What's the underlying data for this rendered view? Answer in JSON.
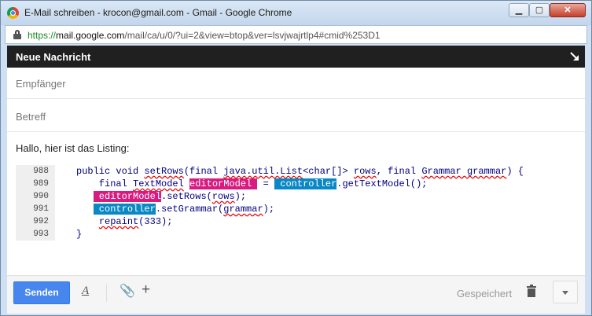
{
  "window": {
    "title": "E-Mail schreiben - krocon@gmail.com - Gmail - Google Chrome",
    "buttons": {
      "minimize": "▁",
      "maximize": "▢",
      "close": "✕"
    }
  },
  "url": {
    "scheme": "https://",
    "host": "mail.google.com",
    "path": "/mail/ca/u/0/?ui=2&view=btop&ver=lsvjwajrtlp4#cmid%253D1"
  },
  "compose": {
    "title": "Neue Nachricht",
    "to_placeholder": "Empfänger",
    "subject_placeholder": "Betreff",
    "greeting": "Hallo, hier ist das Listing:",
    "code_lines": [
      {
        "num": "988",
        "segments": [
          {
            "t": "public void "
          },
          {
            "t": "setRows",
            "sq": true
          },
          {
            "t": "(final "
          },
          {
            "t": "java.util.List",
            "sq": true
          },
          {
            "t": "<char[]> "
          },
          {
            "t": "rows",
            "sq": true
          },
          {
            "t": ", final "
          },
          {
            "t": "Grammar grammar",
            "sq": true
          },
          {
            "t": ") {"
          }
        ]
      },
      {
        "num": "989",
        "segments": [
          {
            "t": "    final "
          },
          {
            "t": "TextModel",
            "sq": true
          },
          {
            "t": " "
          },
          {
            "t": "editorModel ",
            "hl": "pink"
          },
          {
            "t": " = "
          },
          {
            "t": " controller",
            "hl": "blue"
          },
          {
            "t": ".getTextModel();"
          }
        ]
      },
      {
        "num": "990",
        "segments": [
          {
            "t": "   "
          },
          {
            "t": " editorModel",
            "hl": "pink"
          },
          {
            "t": ".setRows("
          },
          {
            "t": "rows",
            "sq": true
          },
          {
            "t": ");"
          }
        ]
      },
      {
        "num": "991",
        "segments": [
          {
            "t": "   "
          },
          {
            "t": " controller",
            "hl": "blue"
          },
          {
            "t": ".setGrammar("
          },
          {
            "t": "grammar",
            "sq": true
          },
          {
            "t": ");"
          }
        ]
      },
      {
        "num": "992",
        "segments": [
          {
            "t": "    "
          },
          {
            "t": "repaint",
            "sq": true
          },
          {
            "t": "(333);"
          }
        ]
      },
      {
        "num": "993",
        "segments": [
          {
            "t": "}"
          }
        ]
      }
    ]
  },
  "toolbar": {
    "send_label": "Senden",
    "format_icon": "A",
    "attach_icon": "📎",
    "plus_icon": "+",
    "saved_text": "Gespeichert"
  }
}
